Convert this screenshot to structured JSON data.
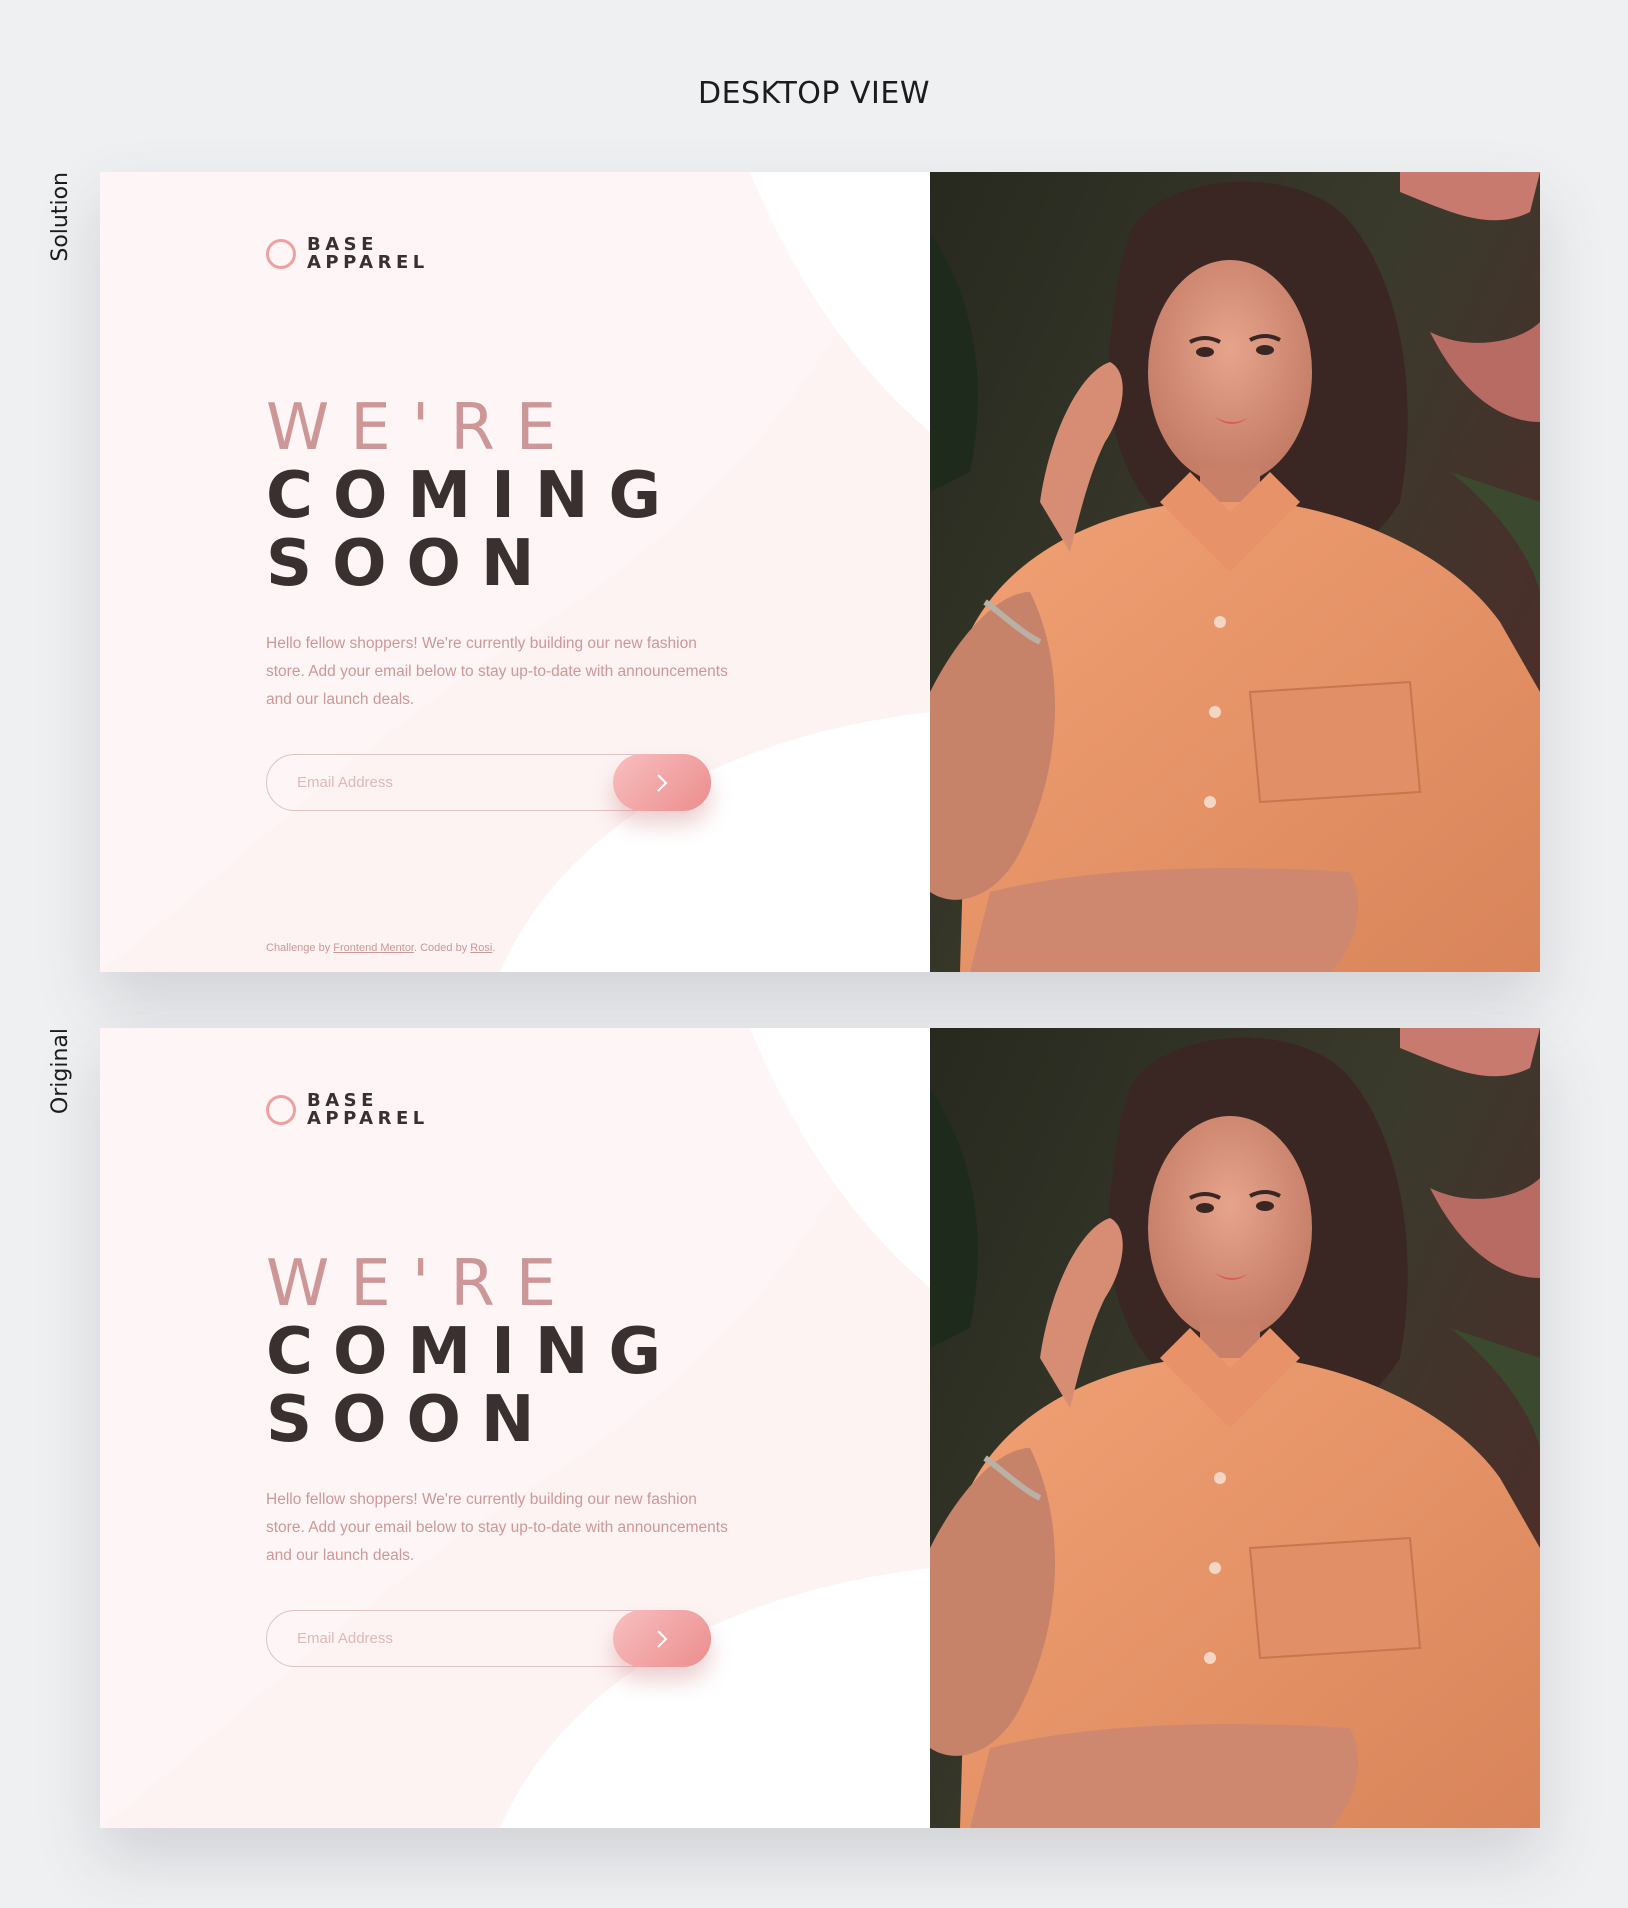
{
  "view_title": "DESKTOP VIEW",
  "panels": [
    {
      "label": "Solution",
      "logo": {
        "line1": "BASE",
        "line2": "APPAREL"
      },
      "heading": {
        "light": "WE'RE",
        "line2": "COMING",
        "line3": "SOON"
      },
      "description": "Hello fellow shoppers! We're currently building our new fashion store. Add your email below to stay up-to-date with announcements and our launch deals.",
      "email_placeholder": "Email Address",
      "submit_icon": "chevron-right-icon",
      "attribution": {
        "prefix": "Challenge by ",
        "link1": "Frontend Mentor",
        "middle": ". Coded by ",
        "link2": "Rosi",
        "suffix": "."
      }
    },
    {
      "label": "Original",
      "logo": {
        "line1": "BASE",
        "line2": "APPAREL"
      },
      "heading": {
        "light": "WE'RE",
        "line2": "COMING",
        "line3": "SOON"
      },
      "description": "Hello fellow shoppers! We're currently building our new fashion store. Add your email below to stay up-to-date with announcements and our launch deals.",
      "email_placeholder": "Email Address",
      "submit_icon": "chevron-right-icon"
    }
  ],
  "colors": {
    "accent_pink": "#ce9797",
    "dark_text": "#3b3030",
    "button_gradient_start": "#f8bfbf",
    "button_gradient_end": "#ec8d8d",
    "page_background": "#eef0f2"
  }
}
